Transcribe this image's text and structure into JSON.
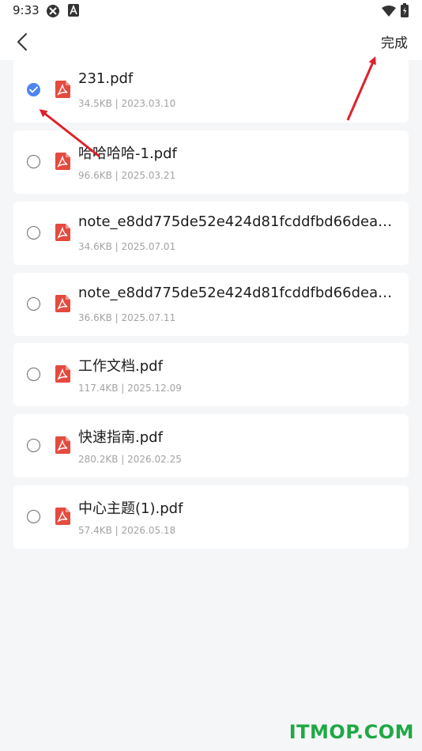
{
  "status_bar": {
    "time": "9:33",
    "icons": [
      "blocky-app-icon",
      "a-letter-icon",
      "wifi-icon",
      "battery-icon"
    ]
  },
  "header": {
    "back_icon": "chevron-left-icon",
    "done_label": "完成"
  },
  "files": [
    {
      "name": "231.pdf",
      "meta": "34.5KB | 2023.03.10",
      "checked": true
    },
    {
      "name": "哈哈哈哈-1.pdf",
      "meta": "96.6KB | 2025.03.21",
      "checked": false
    },
    {
      "name": "note_e8dd775de52e424d81fcddfbd66dea6…",
      "meta": "34.6KB | 2025.07.01",
      "checked": false
    },
    {
      "name": "note_e8dd775de52e424d81fcddfbd66dea6…",
      "meta": "36.6KB | 2025.07.11",
      "checked": false
    },
    {
      "name": "工作文档.pdf",
      "meta": "117.4KB | 2025.12.09",
      "checked": false
    },
    {
      "name": "快速指南.pdf",
      "meta": "280.2KB | 2026.02.25",
      "checked": false
    },
    {
      "name": "中心主题(1).pdf",
      "meta": "57.4KB | 2026.05.18",
      "checked": false
    }
  ],
  "colors": {
    "accent": "#4c84f0",
    "pdf_red": "#e54a3f",
    "annotation_arrow": "#e0202a",
    "watermark": "#1fa845"
  },
  "watermark": "ITMOP.COM"
}
